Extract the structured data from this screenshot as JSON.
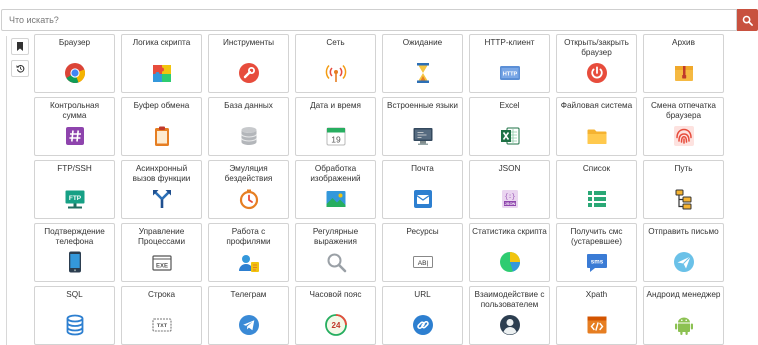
{
  "search": {
    "placeholder": "Что искать?"
  },
  "tiles": [
    {
      "label": "Браузер",
      "icon": "chrome-icon"
    },
    {
      "label": "Логика скрипта",
      "icon": "puzzle-icon"
    },
    {
      "label": "Инструменты",
      "icon": "wrench-icon"
    },
    {
      "label": "Сеть",
      "icon": "antenna-icon"
    },
    {
      "label": "Ожидание",
      "icon": "hourglass-icon"
    },
    {
      "label": "HTTP-клиент",
      "icon": "http-icon"
    },
    {
      "label": "Открыть/закрыть браузер",
      "icon": "power-icon"
    },
    {
      "label": "Архив",
      "icon": "archive-icon"
    },
    {
      "label": "Контрольная сумма",
      "icon": "hash-icon"
    },
    {
      "label": "Буфер обмена",
      "icon": "clipboard-icon"
    },
    {
      "label": "База данных",
      "icon": "database-icon"
    },
    {
      "label": "Дата и время",
      "icon": "calendar-icon",
      "text": "19"
    },
    {
      "label": "Встроенные языки",
      "icon": "monitor-icon"
    },
    {
      "label": "Excel",
      "icon": "excel-icon"
    },
    {
      "label": "Файловая система",
      "icon": "folder-icon"
    },
    {
      "label": "Смена отпечатка браузера",
      "icon": "fingerprint-icon"
    },
    {
      "label": "FTP/SSH",
      "icon": "ftp-icon",
      "text": "FTP"
    },
    {
      "label": "Асинхронный вызов функции",
      "icon": "async-arrows-icon"
    },
    {
      "label": "Эмуляция бездействия",
      "icon": "timer-icon"
    },
    {
      "label": "Обработка изображений",
      "icon": "image-icon"
    },
    {
      "label": "Почта",
      "icon": "mail-icon"
    },
    {
      "label": "JSON",
      "icon": "json-icon",
      "text": "JSON"
    },
    {
      "label": "Список",
      "icon": "list-icon"
    },
    {
      "label": "Путь",
      "icon": "path-icon"
    },
    {
      "label": "Подтверждение телефона",
      "icon": "phone-icon"
    },
    {
      "label": "Управление Процессами",
      "icon": "exe-icon",
      "text": "EXE"
    },
    {
      "label": "Работа с профилями",
      "icon": "profile-icon"
    },
    {
      "label": "Регулярные выражения",
      "icon": "regex-search-icon"
    },
    {
      "label": "Ресурсы",
      "icon": "resource-icon",
      "text": "AB|"
    },
    {
      "label": "Статистика скрипта",
      "icon": "pie-chart-icon"
    },
    {
      "label": "Получить смс (устаревшее)",
      "icon": "sms-icon",
      "text": "sms"
    },
    {
      "label": "Отправить письмо",
      "icon": "send-mail-icon"
    },
    {
      "label": "SQL",
      "icon": "sql-database-icon"
    },
    {
      "label": "Строка",
      "icon": "text-icon",
      "text": "TXT"
    },
    {
      "label": "Телеграм",
      "icon": "telegram-icon"
    },
    {
      "label": "Часовой пояс",
      "icon": "timezone-icon",
      "text": "24"
    },
    {
      "label": "URL",
      "icon": "link-icon"
    },
    {
      "label": "Взаимодействие с пользователем",
      "icon": "user-icon"
    },
    {
      "label": "Xpath",
      "icon": "code-icon"
    },
    {
      "label": "Андроид менеджер",
      "icon": "android-icon"
    }
  ]
}
